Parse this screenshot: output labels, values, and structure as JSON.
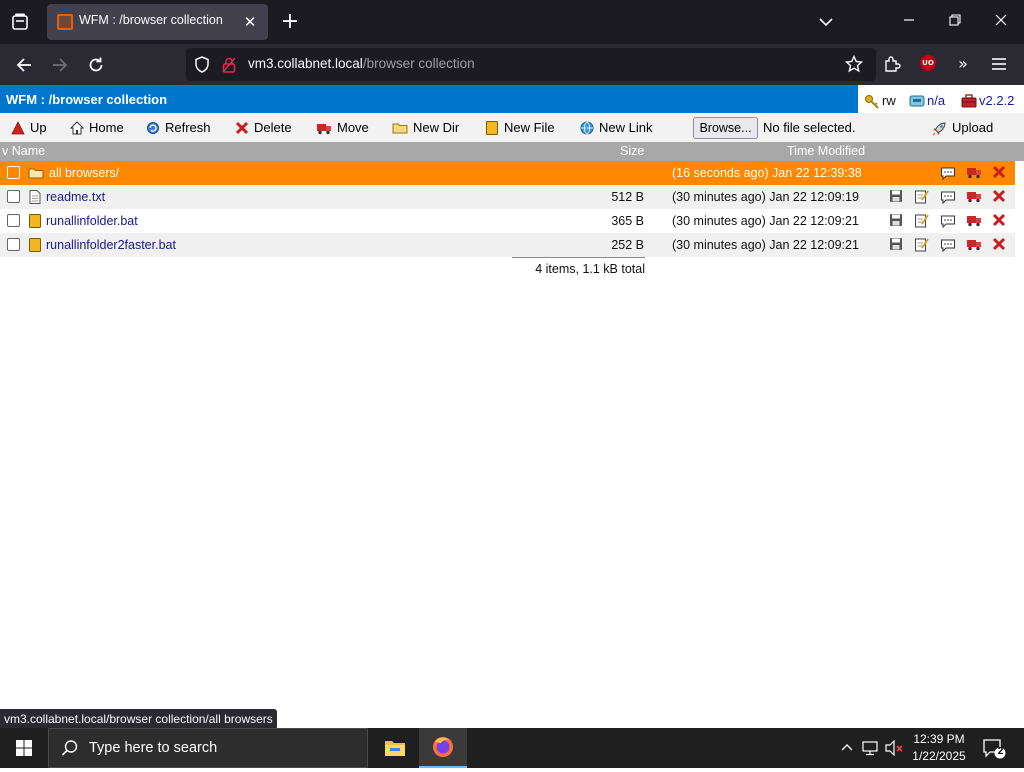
{
  "browser": {
    "tab_title": "WFM : /browser collection",
    "url_host": "vm3.collabnet.local",
    "url_path": "/browser collection",
    "status_url": "vm3.collabnet.local/browser collection/all browsers"
  },
  "app": {
    "header_title": "WFM : /browser collection",
    "permission": "rw",
    "disk": "n/a",
    "version": "v2.2.2"
  },
  "toolbar": {
    "up": "Up",
    "home": "Home",
    "refresh": "Refresh",
    "delete": "Delete",
    "move": "Move",
    "new_dir": "New Dir",
    "new_file": "New File",
    "new_link": "New Link",
    "browse": "Browse...",
    "no_file": "No file selected.",
    "upload": "Upload"
  },
  "columns": {
    "name": "v Name",
    "size": "Size",
    "time": "Time Modified"
  },
  "rows": [
    {
      "name": "all browsers/",
      "size": "",
      "time": "(16 seconds ago) Jan 22 12:39:38",
      "type": "folder",
      "selected": true
    },
    {
      "name": "readme.txt",
      "size": "512 B",
      "time": "(30 minutes ago) Jan 22 12:09:19",
      "type": "text"
    },
    {
      "name": "runallinfolder.bat",
      "size": "365 B",
      "time": "(30 minutes ago) Jan 22 12:09:21",
      "type": "bat"
    },
    {
      "name": "runallinfolder2faster.bat",
      "size": "252 B",
      "time": "(30 minutes ago) Jan 22 12:09:21",
      "type": "bat"
    }
  ],
  "summary": "4 items, 1.1 kB total",
  "taskbar": {
    "search_placeholder": "Type here to search",
    "time": "12:39 PM",
    "date": "1/22/2025",
    "notifications": "2"
  },
  "colors": {
    "header_blue": "#0077cc",
    "selected_row": "#ff8800",
    "column_header": "#a8a8a8"
  }
}
